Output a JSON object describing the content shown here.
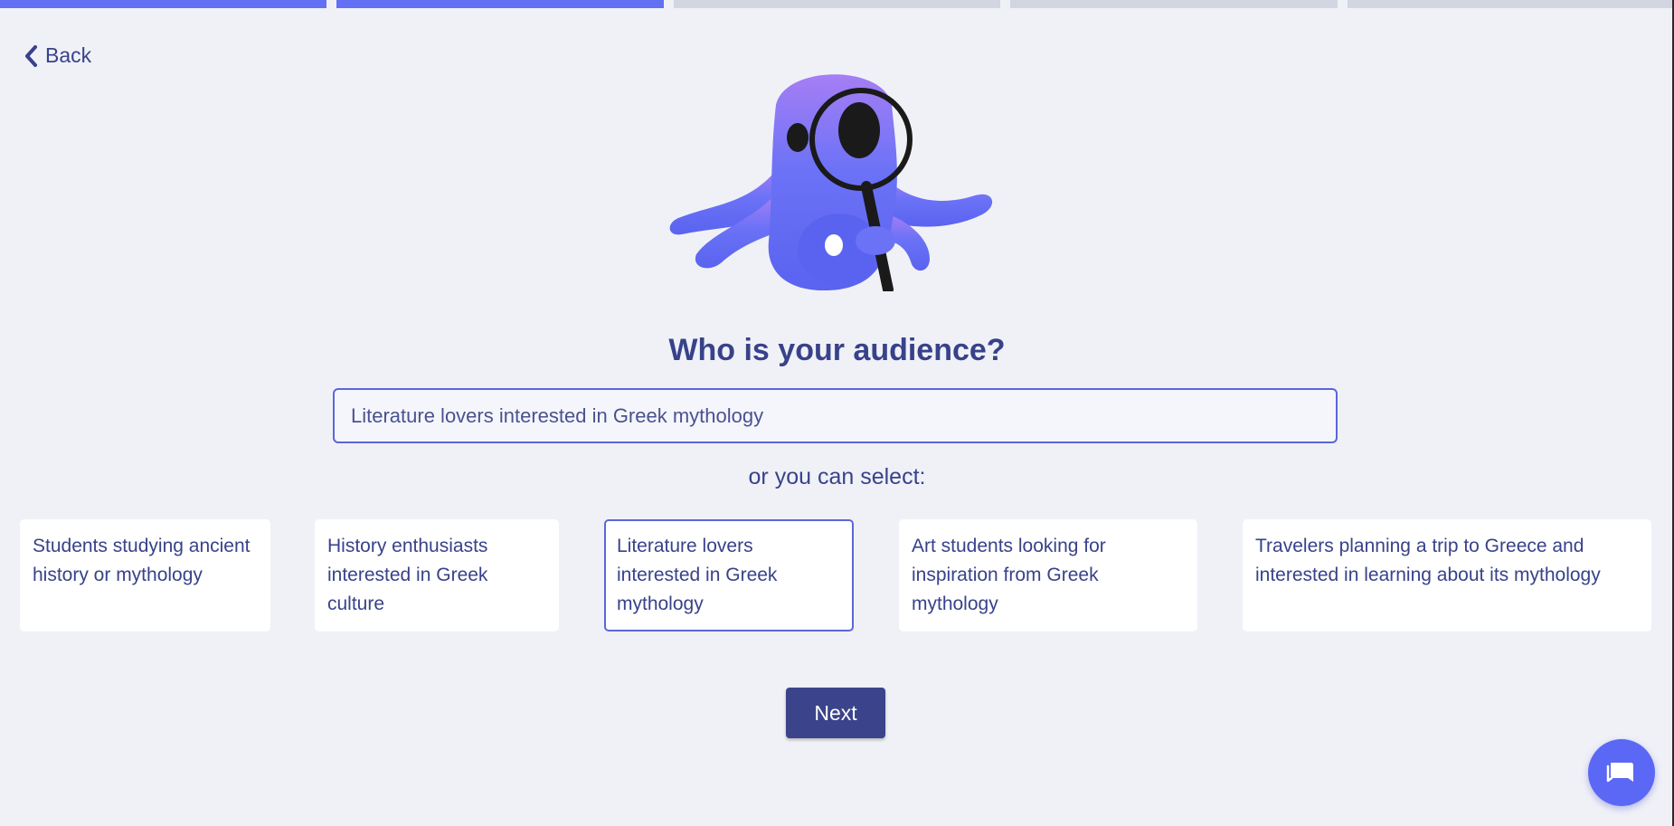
{
  "progress": {
    "total_steps": 5,
    "active_steps": 2
  },
  "nav": {
    "back_label": "Back"
  },
  "question": {
    "title": "Who is your audience?",
    "input_value": "Literature lovers interested in Greek mythology",
    "select_prompt": "or you can select:"
  },
  "options": [
    {
      "label": "Students studying ancient history or mythology",
      "selected": false
    },
    {
      "label": "History enthusiasts interested in Greek culture",
      "selected": false
    },
    {
      "label": "Literature lovers interested in Greek mythology",
      "selected": true
    },
    {
      "label": "Art students looking for inspiration from Greek mythology",
      "selected": false
    },
    {
      "label": "Travelers planning a trip to Greece and interested in learning about its mythology",
      "selected": false
    }
  ],
  "actions": {
    "next_label": "Next"
  },
  "icons": {
    "back": "chevron-left-icon",
    "chat": "chat-bubble-icon",
    "mascot": "octopus-magnifier-illustration"
  },
  "colors": {
    "accent": "#6470f3",
    "primary_button": "#3b448a",
    "text": "#38428a",
    "background": "#f0f1f7"
  }
}
